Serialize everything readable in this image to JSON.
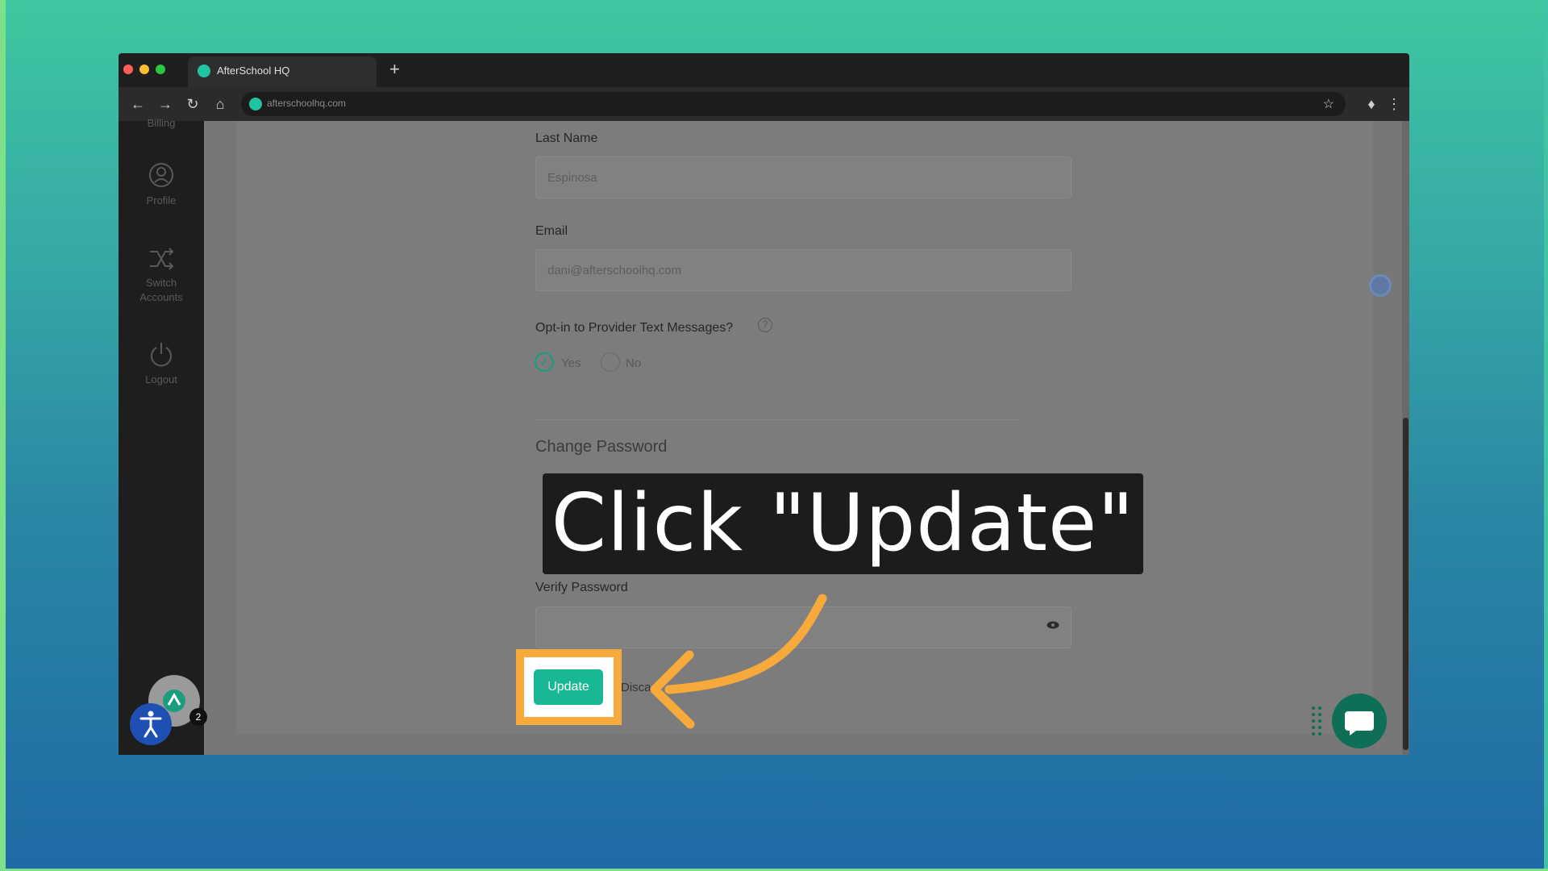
{
  "browser": {
    "tab_title": "AfterSchool HQ",
    "url": "afterschoolhq.com",
    "new_tab_label": "+"
  },
  "sidebar": {
    "items": [
      {
        "label": "Billing",
        "icon": "billing-icon"
      },
      {
        "label": "Profile",
        "icon": "profile-icon"
      },
      {
        "label": "Switch Accounts",
        "icon": "switch-icon"
      },
      {
        "label": "Logout",
        "icon": "power-icon"
      }
    ]
  },
  "form": {
    "last_name_label": "Last Name",
    "last_name_value": "Espinosa",
    "email_label": "Email",
    "email_value": "dani@afterschoolhq.com",
    "optin_label": "Opt-in to Provider Text Messages?",
    "optin_help": "?",
    "radio_yes": "Yes",
    "radio_no": "No",
    "change_password_title": "Change Password",
    "verify_password_label": "Verify Password",
    "update_label": "Update",
    "discard_label": "Disca"
  },
  "callout": {
    "text": "Click \"Update\""
  },
  "badge_count": "2",
  "colors": {
    "accent": "#19b894",
    "highlight": "#f7a93b",
    "callout_bg": "#1c1c1c"
  }
}
